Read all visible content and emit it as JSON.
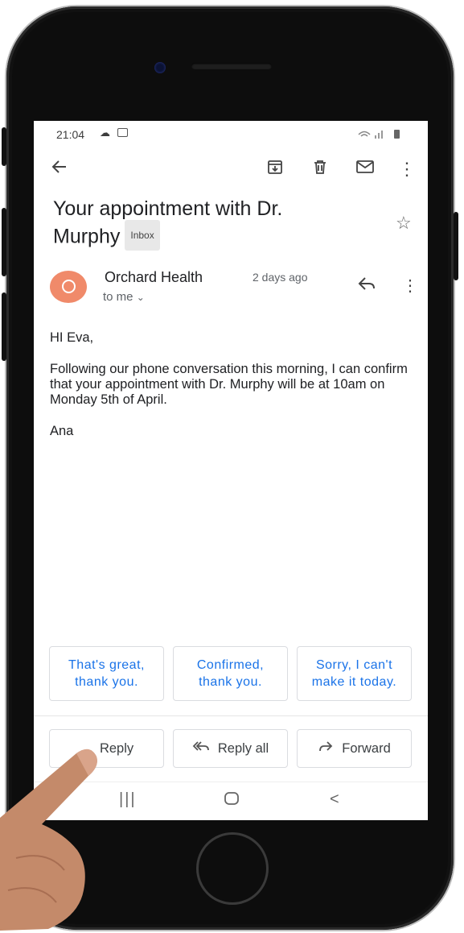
{
  "status": {
    "time": "21:04"
  },
  "toolbar": {
    "back_icon": "arrow-left-icon",
    "archive_icon": "archive-icon",
    "delete_icon": "trash-icon",
    "mail_icon": "mail-icon",
    "more_icon": "more-vert-icon"
  },
  "email": {
    "subject_line1": "Your appointment with Dr.",
    "subject_line2": "Murphy",
    "label": "Inbox",
    "sender": "Orchard Health",
    "date": "2 days ago",
    "recipient": "to me",
    "greeting": "HI Eva,",
    "body": "Following our phone conversation this morning, I can confirm that your appointment with Dr. Murphy will be at 10am on Monday 5th of April.",
    "signature": "Ana"
  },
  "smart_replies": [
    {
      "label": "That's great, thank you."
    },
    {
      "label": "Confirmed, thank you."
    },
    {
      "label": "Sorry, I can't make it today."
    }
  ],
  "actions": {
    "reply": "Reply",
    "reply_all": "Reply all",
    "forward": "Forward"
  },
  "colors": {
    "accent": "#1a73e8",
    "avatar": "#f08a6a",
    "phone": "#0d0d0d"
  }
}
